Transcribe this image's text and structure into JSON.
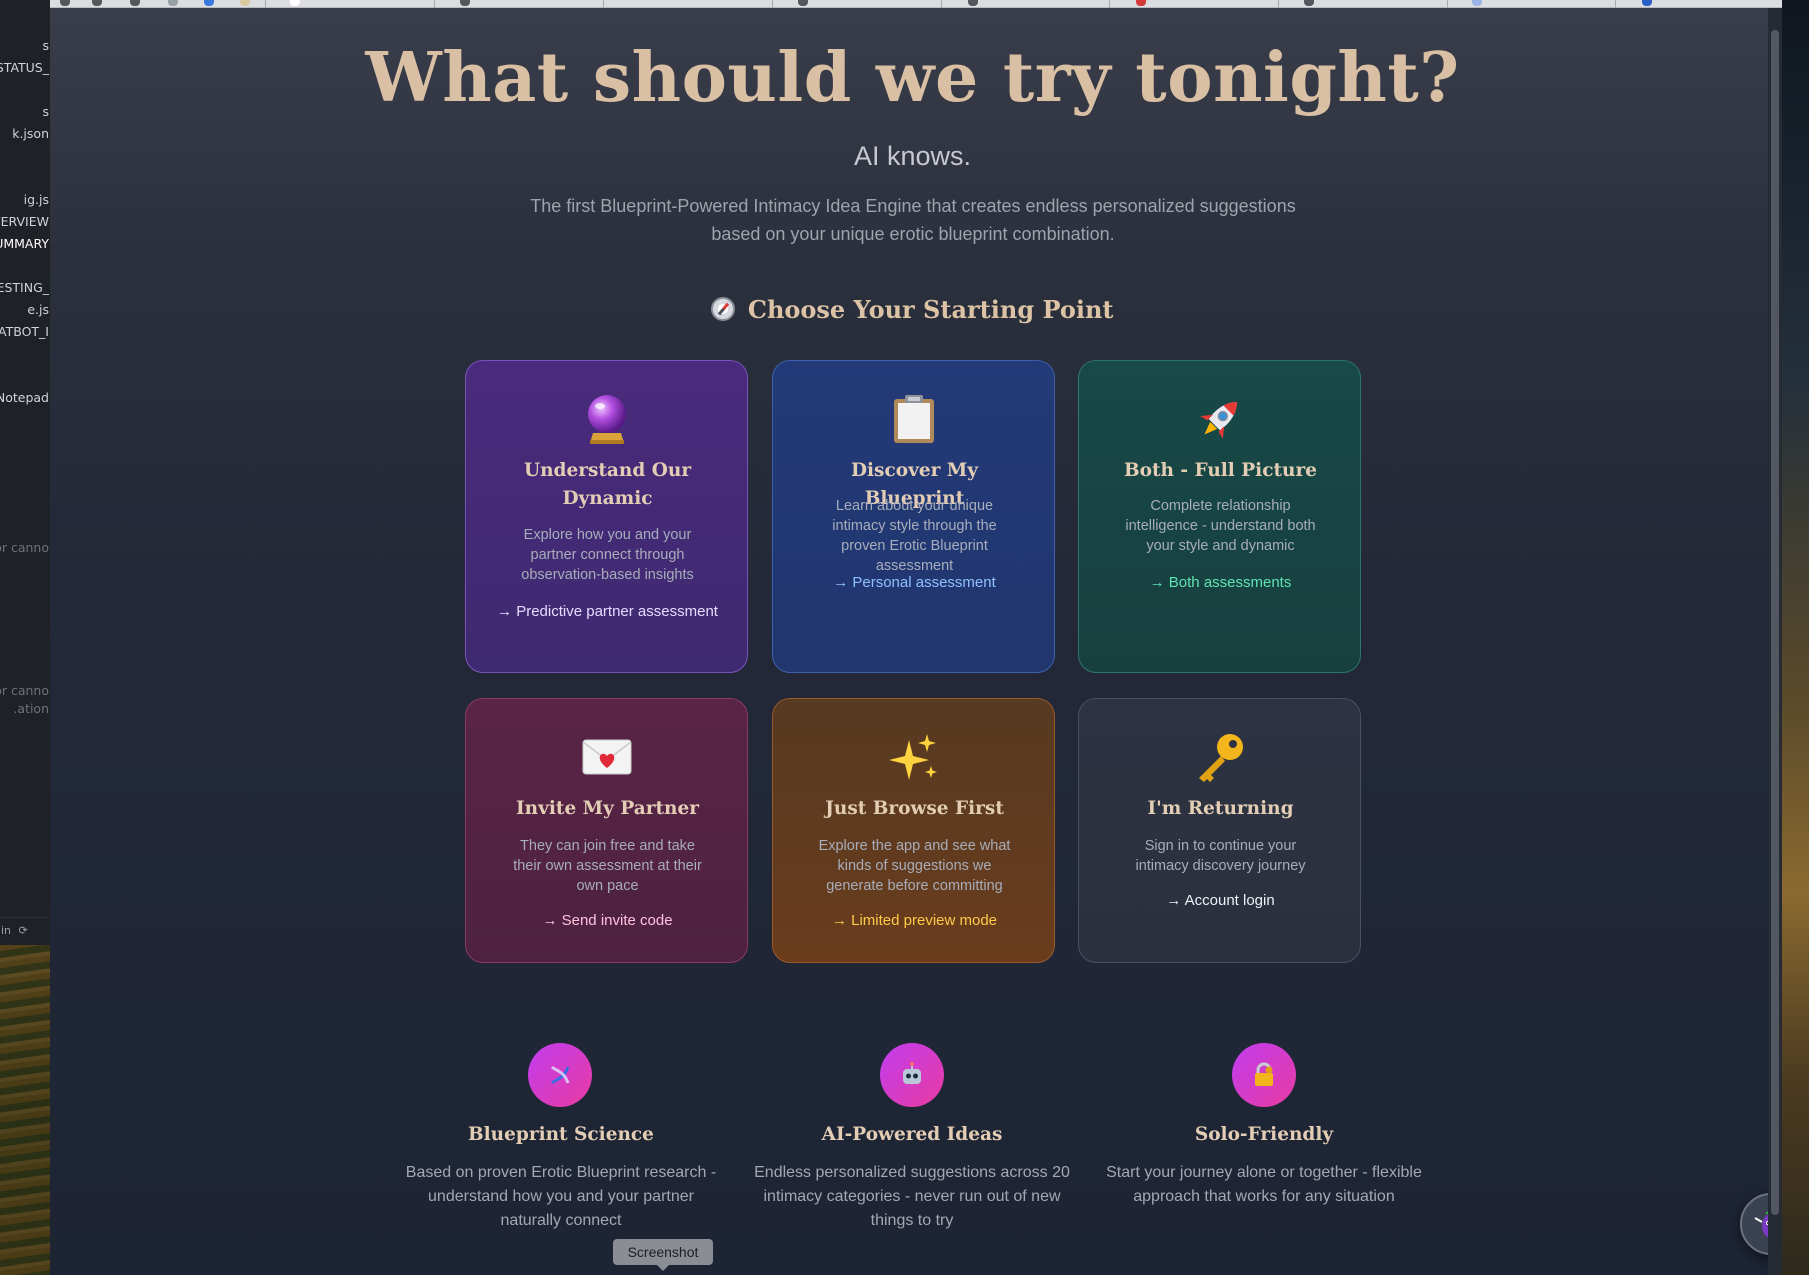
{
  "left_sidebar": {
    "items": [
      "s",
      "_STATUS",
      "s",
      "k.json",
      "ig.js",
      "VERVIEW",
      "UMMARY",
      "_TESTING",
      "e.js",
      "ATBOT_I",
      "Notepad",
      "or canno",
      "or canno",
      "ation."
    ],
    "status_text": "in"
  },
  "hero": {
    "title": "What should we try tonight?",
    "subtitle": "AI knows.",
    "description": "The first Blueprint-Powered Intimacy Idea Engine that creates endless personalized suggestions based on your unique erotic blueprint combination."
  },
  "section": {
    "title": "Choose Your Starting Point",
    "icon": "compass-icon"
  },
  "cards": [
    {
      "title": "Understand Our Dynamic",
      "description": "Explore how you and your partner connect through observation-based insights",
      "cta": "→ Predictive partner assessment",
      "icon": "crystal-ball-icon",
      "color": "#4a2a7c"
    },
    {
      "title": "Discover My Blueprint",
      "description": "Learn about your unique intimacy style through the proven Erotic Blueprint assessment",
      "cta": "→ Personal assessment",
      "icon": "clipboard-icon",
      "color": "#233a78"
    },
    {
      "title": "Both - Full Picture",
      "description": "Complete relationship intelligence - understand both your style and dynamic",
      "cta": "→ Both assessments",
      "icon": "rocket-icon",
      "color": "#174a48"
    },
    {
      "title": "Invite My Partner",
      "description": "They can join free and take their own assessment at their own pace",
      "cta": "→ Send invite code",
      "icon": "love-letter-icon",
      "color": "#5a2446"
    },
    {
      "title": "Just Browse First",
      "description": "Explore the app and see what kinds of suggestions we generate before committing",
      "cta": "→ Limited preview mode",
      "icon": "sparkles-icon",
      "color": "#6a3c1c"
    },
    {
      "title": "I'm Returning",
      "description": "Sign in to continue your intimacy discovery journey",
      "cta": "→ Account login",
      "icon": "key-icon",
      "color": "#2d3342"
    }
  ],
  "features": [
    {
      "title": "Blueprint Science",
      "description": "Based on proven Erotic Blueprint research - understand how you and your partner naturally connect",
      "icon": "dna-icon"
    },
    {
      "title": "AI-Powered Ideas",
      "description": "Endless personalized suggestions across 20 intimacy categories - never run out of new things to try",
      "icon": "robot-icon"
    },
    {
      "title": "Solo-Friendly",
      "description": "Start your journey alone or together - flexible approach that works for any situation",
      "icon": "lock-key-icon"
    }
  ],
  "tooltip": {
    "text": "Screenshot"
  },
  "chat_button": {
    "icon": "eggplant-mascot-icon"
  },
  "colors": {
    "heading": "#d9bfa3",
    "feature_gradient_start": "#c13cf0",
    "feature_gradient_end": "#e83ba0",
    "cta_green": "#5fe3b3",
    "cta_blue": "#8fc0ff",
    "cta_amber": "#ffc94a"
  }
}
